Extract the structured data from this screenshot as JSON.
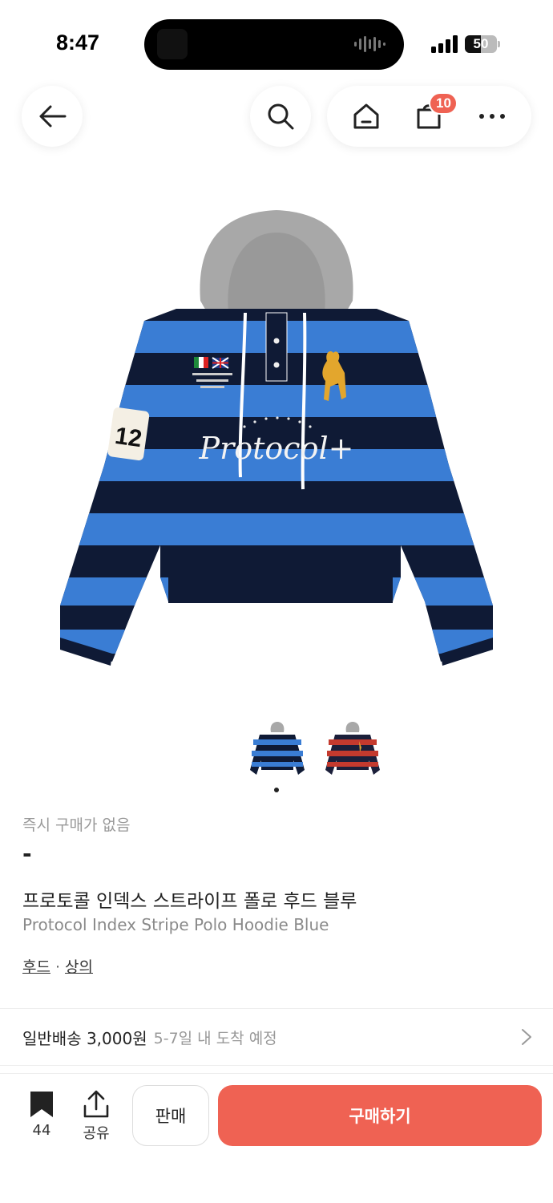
{
  "status_bar": {
    "time": "8:47",
    "battery": "50"
  },
  "nav": {
    "cart_count": "10"
  },
  "product": {
    "instant_label": "즉시 구매가 없음",
    "price": "-",
    "name_ko": "프로토콜 인덱스 스트라이프 폴로 후드 블루",
    "name_en": "Protocol Index Stripe Polo Hoodie Blue",
    "categories": [
      "후드",
      "상의"
    ],
    "category_sep": "·",
    "image_text": {
      "patch_number": "12",
      "chest_logo": "Protocol+"
    }
  },
  "thumbnails": [
    {
      "name": "blue-hoodie",
      "stripe_color": "#3a7dd4"
    },
    {
      "name": "red-hoodie",
      "stripe_color": "#c43a2e"
    }
  ],
  "shipping": {
    "main": "일반배송 3,000원",
    "sub": "5-7일 내 도착 예정"
  },
  "bottom_bar": {
    "bookmark_count": "44",
    "share_label": "공유",
    "sell_label": "판매",
    "buy_label": "구매하기"
  },
  "colors": {
    "accent": "#ef6253",
    "stripe_blue": "#3a7dd4",
    "stripe_navy": "#0f1a35",
    "hood_gray": "#a8a8a8"
  }
}
